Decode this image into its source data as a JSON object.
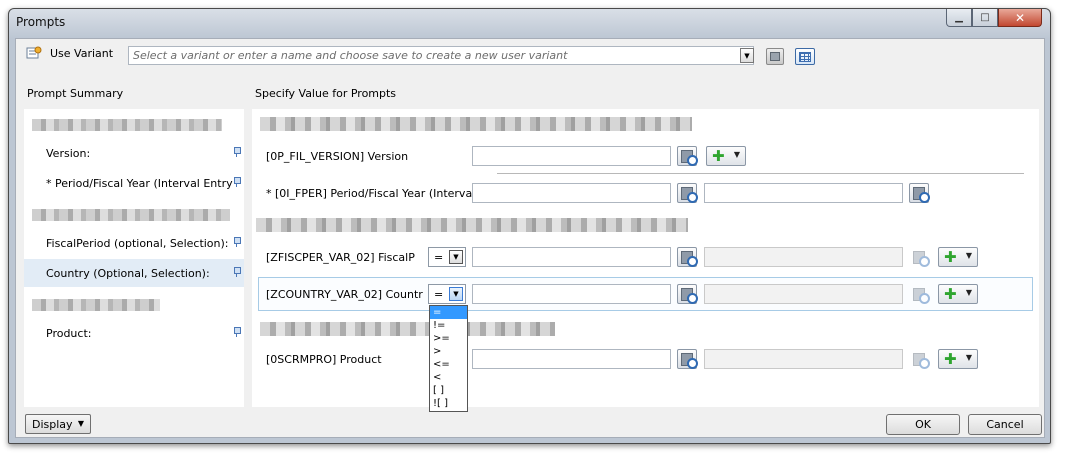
{
  "window": {
    "title": "Prompts",
    "controls": [
      "minimize",
      "maximize",
      "close"
    ]
  },
  "variant": {
    "label": "Use Variant",
    "placeholder": "Select a variant or enter a name and choose save to create a new user variant",
    "icon": "variant-icon"
  },
  "summary": {
    "header": "Prompt Summary",
    "items": [
      {
        "label": "Version:"
      },
      {
        "label": "* Period/Fiscal Year (Interval Entry"
      },
      {
        "label": "FiscalPeriod (optional, Selection):"
      },
      {
        "label": "Country (Optional, Selection):",
        "selected": true
      },
      {
        "label": "Product:"
      }
    ]
  },
  "specify": {
    "header": "Specify Value for Prompts",
    "rows": [
      {
        "label": "[0P_FIL_VERSION] Version"
      },
      {
        "label": "* [0I_FPER] Period/Fiscal Year (Interval"
      },
      {
        "label": "[ZFISCPER_VAR_02] FiscalP",
        "operator": "="
      },
      {
        "label": "[ZCOUNTRY_VAR_02] Countr",
        "operator": "="
      },
      {
        "label": "[0SCRMPRO] Product"
      }
    ]
  },
  "operator_dropdown": {
    "options": [
      "=",
      "!=",
      ">=",
      ">",
      "<=",
      "<",
      "[ ]",
      "![ ]"
    ],
    "selected": "="
  },
  "footer": {
    "display_label": "Display",
    "ok_label": "OK",
    "cancel_label": "Cancel"
  },
  "colors": {
    "selection": "#e2ecf6",
    "dropdown_highlight": "#3399ff",
    "add_plus": "#2fa52f"
  }
}
